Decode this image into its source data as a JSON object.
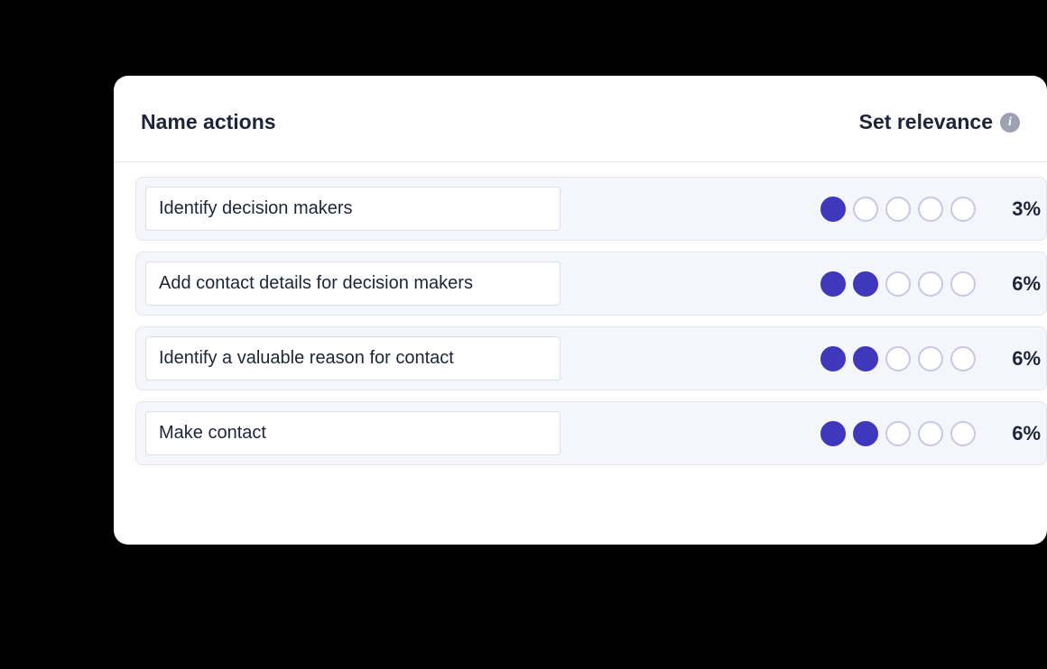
{
  "header": {
    "name_actions": "Name actions",
    "set_relevance": "Set relevance"
  },
  "info_glyph": "i",
  "dot_count": 5,
  "rows": [
    {
      "label": "Identify decision makers",
      "relevance": 1,
      "percent": "3%"
    },
    {
      "label": "Add contact details for decision makers",
      "relevance": 2,
      "percent": "6%"
    },
    {
      "label": "Identify a valuable reason for contact",
      "relevance": 2,
      "percent": "6%"
    },
    {
      "label": "Make contact",
      "relevance": 2,
      "percent": "6%"
    }
  ]
}
